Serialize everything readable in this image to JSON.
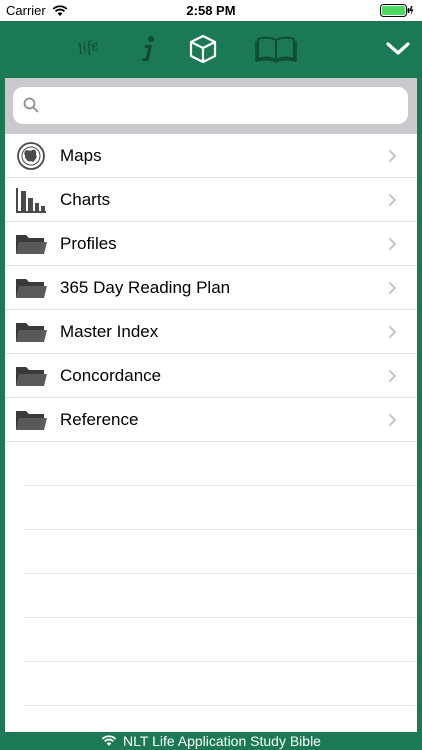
{
  "status_bar": {
    "carrier": "Carrier",
    "time": "2:58 PM"
  },
  "toolbar": {
    "buttons": [
      {
        "name": "life-logo",
        "icon": "life-logo-icon"
      },
      {
        "name": "info",
        "icon": "info-icon"
      },
      {
        "name": "resources",
        "icon": "cube-icon"
      },
      {
        "name": "bible",
        "icon": "open-book-icon"
      },
      {
        "name": "collapse",
        "icon": "chevron-down-icon"
      }
    ],
    "logo_text": "life"
  },
  "search": {
    "value": "",
    "placeholder": ""
  },
  "menu": {
    "items": [
      {
        "label": "Maps",
        "icon": "globe-icon"
      },
      {
        "label": "Charts",
        "icon": "bar-chart-icon"
      },
      {
        "label": "Profiles",
        "icon": "folder-icon"
      },
      {
        "label": "365 Day Reading Plan",
        "icon": "folder-icon"
      },
      {
        "label": "Master Index",
        "icon": "folder-icon"
      },
      {
        "label": "Concordance",
        "icon": "folder-icon"
      },
      {
        "label": "Reference",
        "icon": "folder-icon"
      }
    ]
  },
  "footer": {
    "title": "NLT Life Application Study Bible"
  },
  "colors": {
    "brand_green": "#1b7a55",
    "search_bar_gray": "#c9c9ce",
    "battery_green": "#4cd964"
  }
}
